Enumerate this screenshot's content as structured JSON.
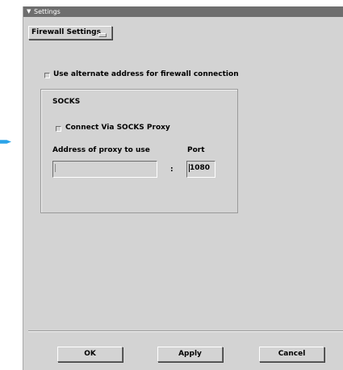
{
  "window": {
    "title": "Settings"
  },
  "category": {
    "selected": "Firewall Settings"
  },
  "alternate_address": {
    "label": "Use alternate address for firewall connection",
    "checked": false
  },
  "socks": {
    "group_label": "SOCKS",
    "connect_label": "Connect Via SOCKS Proxy",
    "connect_checked": false,
    "address_label": "Address of proxy to use",
    "address_value": "",
    "separator": ":",
    "port_label": "Port",
    "port_value": "1080"
  },
  "buttons": {
    "ok": "OK",
    "apply": "Apply",
    "cancel": "Cancel"
  },
  "colors": {
    "pointer": "#2aa3e8",
    "title_bar": "#6e6e6e",
    "panel": "#d3d3d3"
  },
  "icons": {
    "window_menu": "chevron-down-icon",
    "dropdown": "option-menu-indicator-icon",
    "pointer": "blue-pointer-arrow-icon"
  }
}
